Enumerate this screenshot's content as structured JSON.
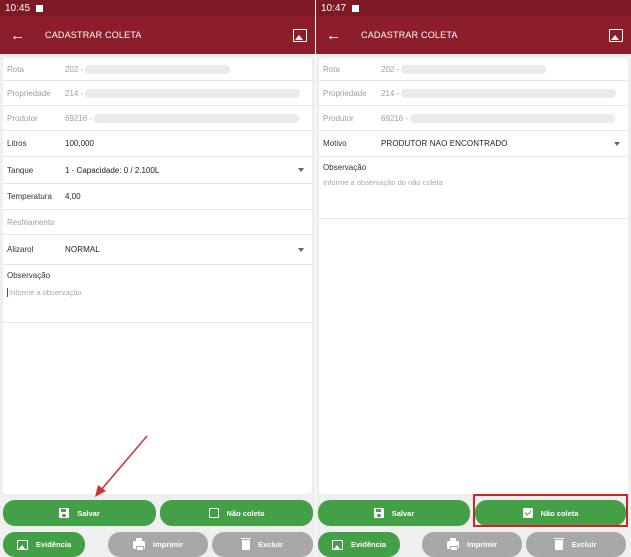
{
  "left": {
    "status": {
      "time": "10:45"
    },
    "appbar": {
      "title": "CADASTRAR COLETA"
    },
    "fields": {
      "rota": {
        "label": "Rota",
        "value": "202 -"
      },
      "propriedade": {
        "label": "Propriedade",
        "value": "214 -"
      },
      "produtor": {
        "label": "Produtor",
        "value": "69216 -"
      },
      "litros": {
        "label": "Litros",
        "value": "100,000"
      },
      "tanque": {
        "label": "Tanque",
        "value": "1  -  Capacidade: 0 / 2.100L"
      },
      "temperatura": {
        "label": "Temperatura",
        "value": "4,00"
      },
      "resfriamento": {
        "label": "Resfriamento"
      },
      "alizarol": {
        "label": "Alizarol",
        "value": "NORMAL"
      },
      "observacao": {
        "label": "Observação",
        "placeholder": "Informe a observação"
      }
    },
    "buttons": {
      "salvar": "Salvar",
      "nao_coleta": "Não coleta",
      "evidencia": "Evidência",
      "imprimir": "Imprimir",
      "excluir": "Excluir"
    }
  },
  "right": {
    "status": {
      "time": "10:47"
    },
    "appbar": {
      "title": "CADASTRAR COLETA"
    },
    "fields": {
      "rota": {
        "label": "Rota",
        "value": "202 -"
      },
      "propriedade": {
        "label": "Propriedade",
        "value": "214 -"
      },
      "produtor": {
        "label": "Produtor",
        "value": "69216 -"
      },
      "motivo": {
        "label": "Motivo",
        "value": "PRODUTOR NAO ENCONTRADO"
      },
      "observacao": {
        "label": "Observação",
        "placeholder": "Informe a observação do não coleta"
      }
    },
    "buttons": {
      "salvar": "Salvar",
      "nao_coleta": "Não coleta",
      "evidencia": "Evidência",
      "imprimir": "Imprimir",
      "excluir": "Excluir"
    }
  },
  "colors": {
    "appbar": "#8c1d2a",
    "statusbar": "#7d1a26",
    "green_button": "#43a047",
    "grey_button": "#a8a8a8",
    "highlight": "#c62828",
    "annotation_arrow": "#d32f2f"
  }
}
